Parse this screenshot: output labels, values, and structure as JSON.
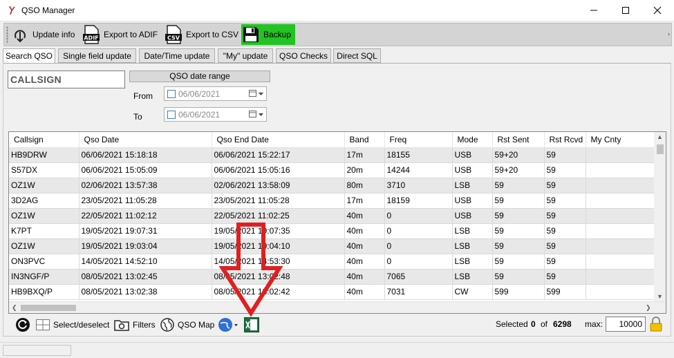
{
  "window": {
    "title": "QSO Manager",
    "controls": {
      "minimize_icon": "minimize-icon",
      "maximize_icon": "maximize-icon",
      "close_icon": "close-icon"
    }
  },
  "toolbar": {
    "buttons": [
      {
        "label": "Update info",
        "icon": "download-icon"
      },
      {
        "label": "Export to ADIF",
        "icon": "adif-file-icon",
        "icon_text": "ADIF"
      },
      {
        "label": "Export to CSV",
        "icon": "csv-file-icon",
        "icon_text": "CSV"
      },
      {
        "label": "Backup",
        "icon": "floppy-disk-icon",
        "highlight_color": "#22c322"
      }
    ]
  },
  "tabs": [
    {
      "label": "Search QSO",
      "active": true
    },
    {
      "label": "Single field update"
    },
    {
      "label": "Date/Time update"
    },
    {
      "label": "\"My\" update"
    },
    {
      "label": "QSO Checks"
    },
    {
      "label": "Direct SQL"
    }
  ],
  "search": {
    "callsign_placeholder": "CALLSIGN",
    "date_range_label": "QSO date range",
    "from_label": "From",
    "to_label": "To",
    "from_value": "06/06/2021",
    "to_value": "06/06/2021"
  },
  "grid": {
    "columns": [
      "Callsign",
      "Qso Date",
      "Qso End Date",
      "Band",
      "Freq",
      "Mode",
      "Rst Sent",
      "Rst Rcvd",
      "My Cnty"
    ],
    "rows": [
      [
        "HB9DRW",
        "06/06/2021 15:18:18",
        "06/06/2021 15:22:17",
        "17m",
        "18155",
        "USB",
        "59+20",
        "59",
        ""
      ],
      [
        "S57DX",
        "06/06/2021 15:05:09",
        "06/06/2021 15:05:16",
        "20m",
        "14244",
        "USB",
        "59+20",
        "59",
        ""
      ],
      [
        "OZ1W",
        "02/06/2021 13:57:38",
        "02/06/2021 13:58:09",
        "80m",
        "3710",
        "LSB",
        "59",
        "59",
        ""
      ],
      [
        "3D2AG",
        "23/05/2021 11:05:28",
        "23/05/2021 11:05:28",
        "17m",
        "18159",
        "USB",
        "59",
        "59",
        ""
      ],
      [
        "OZ1W",
        "22/05/2021 11:02:12",
        "22/05/2021 11:02:25",
        "40m",
        "0",
        "USB",
        "59",
        "59",
        ""
      ],
      [
        "K7PT",
        "19/05/2021 19:07:31",
        "19/05/2021 19:07:35",
        "40m",
        "0",
        "LSB",
        "59",
        "59",
        ""
      ],
      [
        "OZ1W",
        "19/05/2021 19:03:04",
        "19/05/2021 19:04:10",
        "40m",
        "0",
        "LSB",
        "59",
        "59",
        ""
      ],
      [
        "ON3PVC",
        "14/05/2021 14:52:10",
        "14/05/2021 14:53:30",
        "40m",
        "0",
        "LSB",
        "59",
        "59",
        ""
      ],
      [
        "IN3NGF/P",
        "08/05/2021 13:02:45",
        "08/05/2021 13:02:48",
        "40m",
        "7065",
        "LSB",
        "59",
        "59",
        ""
      ],
      [
        "HB9BXQ/P",
        "08/05/2021 13:02:38",
        "08/05/2021 13:02:42",
        "40m",
        "7031",
        "CW",
        "599",
        "599",
        ""
      ]
    ]
  },
  "bottombar": {
    "refresh_icon": "refresh-icon",
    "select_label": "Select/deselect",
    "filters_label": "Filters",
    "map_label": "QSO Map",
    "earth_icon": "google-earth-icon",
    "excel_icon": "excel-icon",
    "selected_label": "Selected",
    "selected_count": "0",
    "of_label": "of",
    "total_count": "6298",
    "max_label": "max:",
    "max_value": "10000",
    "lock_icon": "lock-icon"
  },
  "annotation": {
    "arrow_color": "#e02020",
    "icon": "down-arrow-annotation"
  }
}
